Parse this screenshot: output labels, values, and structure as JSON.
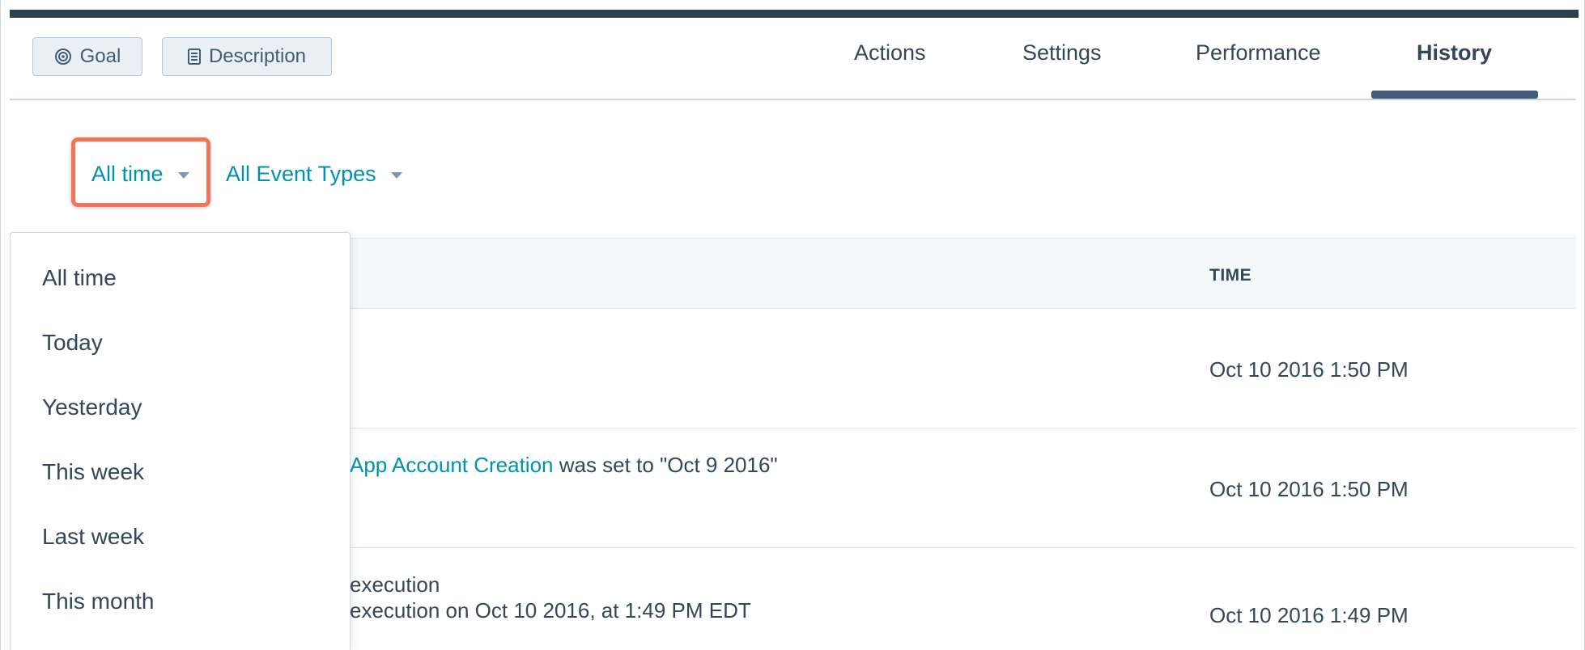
{
  "toolbar": {
    "goal_label": "Goal",
    "description_label": "Description"
  },
  "tabs": [
    {
      "label": "Actions"
    },
    {
      "label": "Settings"
    },
    {
      "label": "Performance"
    },
    {
      "label": "History",
      "active": true
    }
  ],
  "filters": {
    "time_selected": "All time",
    "event_types_selected": "All Event Types"
  },
  "table": {
    "columns": {
      "time": "TIME"
    },
    "rows": [
      {
        "time": "Oct 10 2016 1:50 PM"
      },
      {
        "event_link": "App Account Creation",
        "event_text": " was set to \"Oct 9 2016\"",
        "time": "Oct 10 2016 1:50 PM"
      },
      {
        "event_line1": "execution",
        "event_line2": "execution on Oct 10 2016, at 1:49 PM EDT",
        "time": "Oct 10 2016 1:49 PM"
      }
    ]
  },
  "time_dropdown": {
    "options": [
      "All time",
      "Today",
      "Yesterday",
      "This week",
      "Last week",
      "This month"
    ]
  },
  "colors": {
    "accent": "#0091ae",
    "highlight": "#f2755a",
    "text": "#33475b",
    "dark_bar": "#2d3e50"
  }
}
